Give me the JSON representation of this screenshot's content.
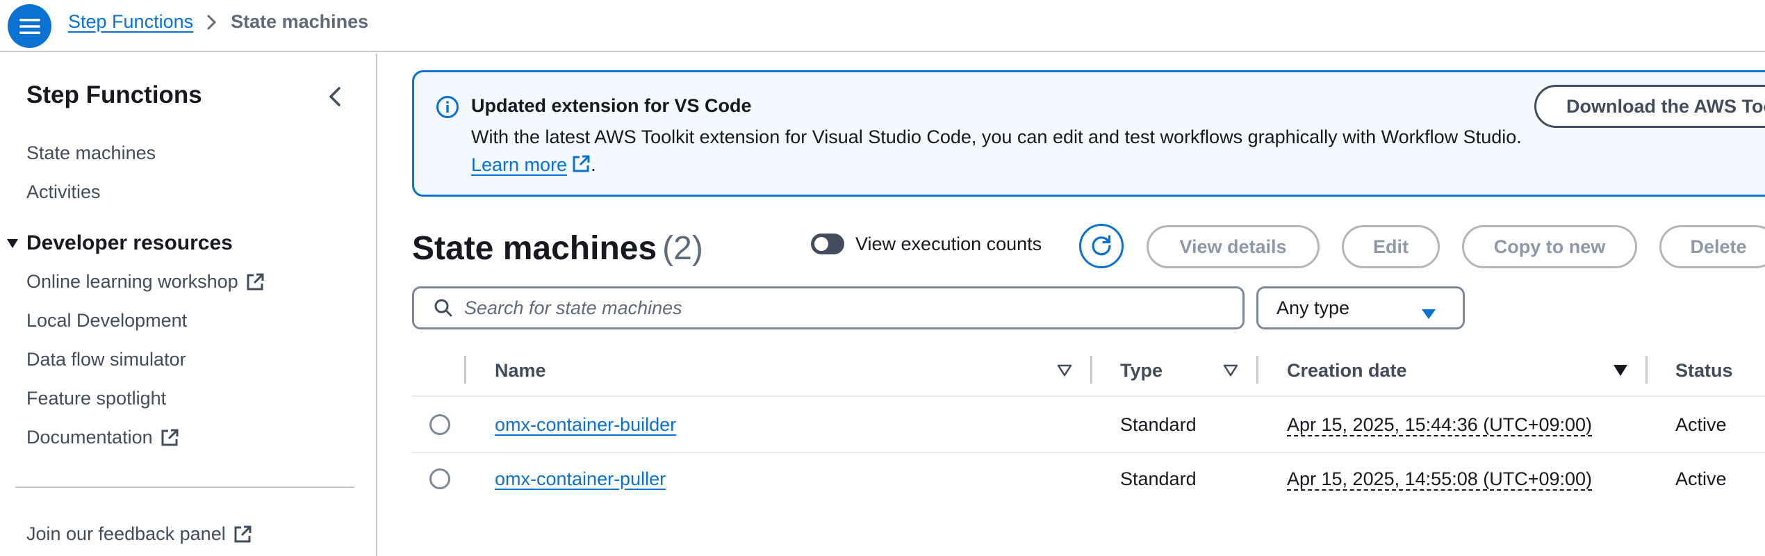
{
  "header": {
    "breadcrumb": {
      "service": "Step Functions",
      "current": "State machines"
    }
  },
  "sidebar": {
    "title": "Step Functions",
    "items": [
      {
        "label": "State machines"
      },
      {
        "label": "Activities"
      }
    ],
    "developer_section": {
      "title": "Developer resources",
      "items": [
        {
          "label": "Online learning workshop",
          "external": true
        },
        {
          "label": "Local Development",
          "external": false
        },
        {
          "label": "Data flow simulator",
          "external": false
        },
        {
          "label": "Feature spotlight",
          "external": false
        },
        {
          "label": "Documentation",
          "external": true
        }
      ]
    },
    "feedback_label": "Join our feedback panel"
  },
  "banner": {
    "title": "Updated extension for VS Code",
    "text": "With the latest AWS Toolkit extension for Visual Studio Code, you can edit and test workflows graphically with Workflow Studio.",
    "link_label": "Learn more",
    "trailing": ".",
    "button_label": "Download the AWS Toolkit"
  },
  "main": {
    "title": "State machines",
    "count": "(2)",
    "toggle_label": "View execution counts",
    "toggle_on": false,
    "actions": {
      "view_details": "View details",
      "edit": "Edit",
      "copy": "Copy to new",
      "delete": "Delete"
    },
    "search_placeholder": "Search for state machines",
    "type_filter": "Any type"
  },
  "table": {
    "columns": {
      "name": "Name",
      "type": "Type",
      "creation_date": "Creation date",
      "status": "Status"
    },
    "rows": [
      {
        "name": "omx-container-builder",
        "type": "Standard",
        "created": "Apr 15, 2025, 15:44:36 (UTC+09:00)",
        "status": "Active"
      },
      {
        "name": "omx-container-puller",
        "type": "Standard",
        "created": "Apr 15, 2025, 14:55:08 (UTC+09:00)",
        "status": "Active"
      }
    ]
  },
  "colors": {
    "accent": "#0972d3",
    "text": "#16191f",
    "muted": "#5f6b7a",
    "border": "#c6c6cd",
    "banner_bg": "#f2f8fd"
  }
}
